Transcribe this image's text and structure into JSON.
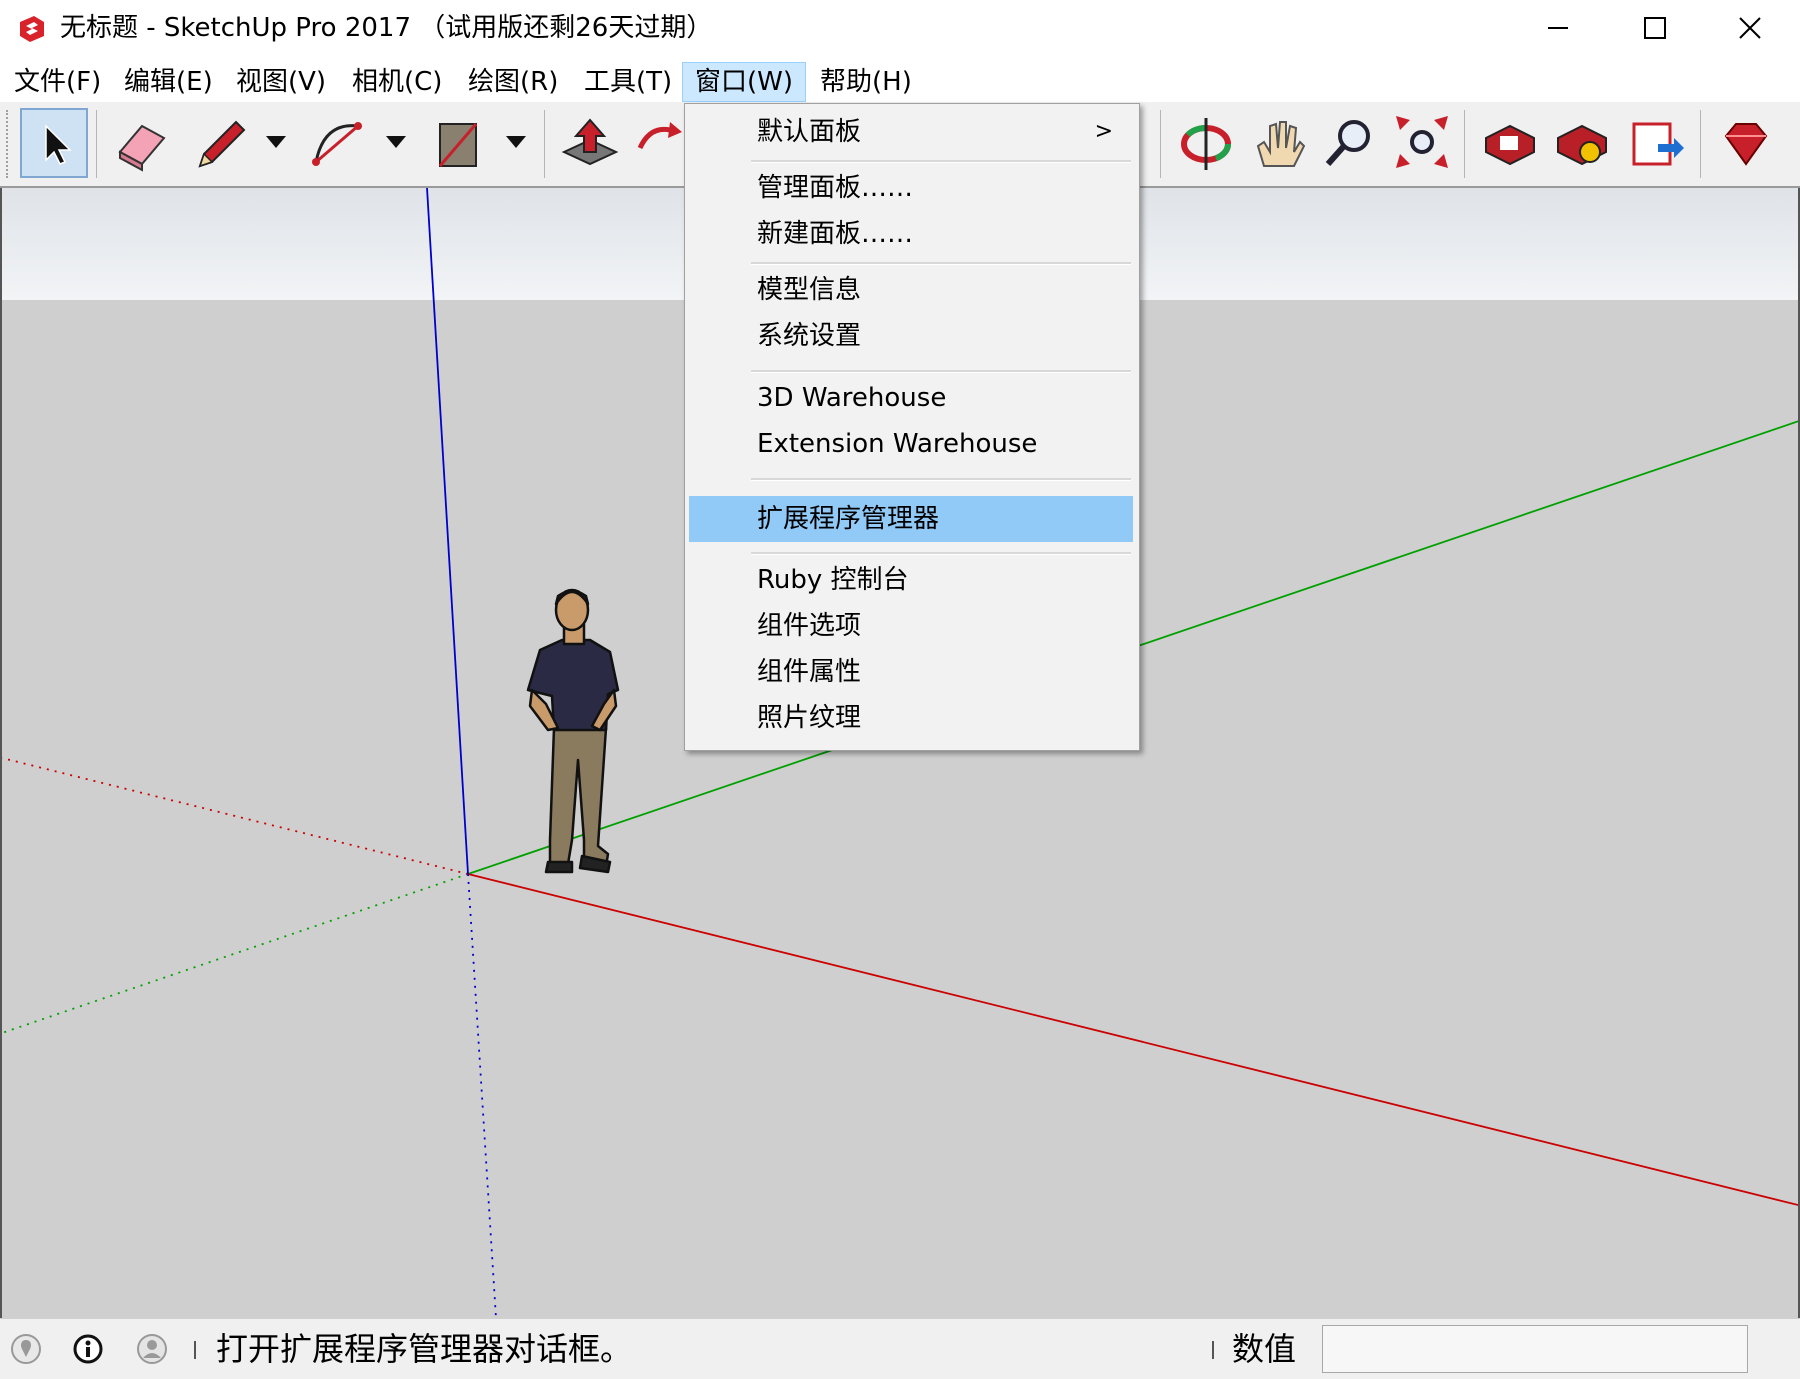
{
  "window": {
    "title": "无标题 - SketchUp Pro 2017 （试用版还剩26天过期）",
    "app_icon": "sketchup-logo-icon",
    "controls": [
      "minimize-icon",
      "maximize-icon",
      "close-icon"
    ]
  },
  "menubar": {
    "items": [
      {
        "label": "文件(F)"
      },
      {
        "label": "编辑(E)"
      },
      {
        "label": "视图(V)"
      },
      {
        "label": "相机(C)"
      },
      {
        "label": "绘图(R)"
      },
      {
        "label": "工具(T)"
      },
      {
        "label": "窗口(W)",
        "active": true
      },
      {
        "label": "帮助(H)"
      }
    ]
  },
  "toolbar": {
    "tools": [
      "select-icon",
      "eraser-icon",
      "pencil-icon",
      "arc-icon",
      "rectangle-icon",
      "push-pull-icon",
      "move-icon",
      "orbit-icon",
      "pan-icon",
      "zoom-icon",
      "zoom-extents-icon",
      "3d-warehouse-icon",
      "extension-warehouse-icon",
      "share-model-icon",
      "extension-manager-ruby-icon"
    ],
    "selected": "select-icon"
  },
  "window_menu": {
    "items": [
      {
        "label": "默认面板",
        "submenu": true
      },
      {
        "label": "管理面板……"
      },
      {
        "label": "新建面板……"
      },
      {
        "label": "模型信息"
      },
      {
        "label": "系统设置"
      },
      {
        "label": "3D Warehouse"
      },
      {
        "label": "Extension Warehouse"
      },
      {
        "label": "扩展程序管理器",
        "highlighted": true
      },
      {
        "label": "Ruby 控制台"
      },
      {
        "label": "组件选项"
      },
      {
        "label": "组件属性"
      },
      {
        "label": "照片纹理"
      }
    ],
    "submenu_arrow": ">"
  },
  "statusbar": {
    "icons": [
      "geo-location-icon",
      "info-icon",
      "user-icon"
    ],
    "message": "打开扩展程序管理器对话框。",
    "vcb_label": "数值",
    "vcb_value": ""
  },
  "colors": {
    "highlight": "#91c9f7",
    "menu_active": "#cce8ff",
    "axis_red": "#cc0000",
    "axis_green": "#00a000",
    "axis_blue": "#0000cc",
    "ground": "#cfcfcf"
  }
}
